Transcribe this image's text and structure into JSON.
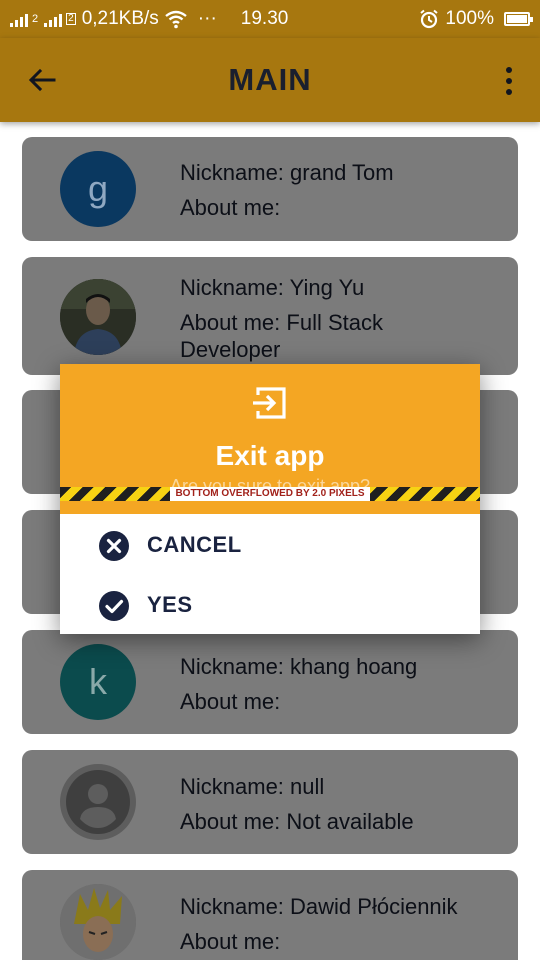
{
  "status_bar": {
    "network_speed": "0,21KB/s",
    "dots": "···",
    "time": "19.30",
    "battery": "100%",
    "sim_label": "2",
    "icons": [
      "signal-icon",
      "signal-icon",
      "wifi-icon",
      "alarm-icon",
      "battery-icon"
    ]
  },
  "app_bar": {
    "title": "MAIN",
    "icons": [
      "arrow-back-icon",
      "more-vert-icon"
    ]
  },
  "users": [
    {
      "avatar_type": "letter",
      "letter": "g",
      "avatar_color": "#0a3860",
      "letter_color": "#8fa8c2",
      "nickname": "Nickname: grand Tom",
      "about": "About me:"
    },
    {
      "avatar_type": "photo",
      "nickname": "Nickname: Ying Yu",
      "about": "About me: Full Stack Developer"
    },
    {
      "avatar_type": "hidden",
      "nickname": "",
      "about": ""
    },
    {
      "avatar_type": "hidden",
      "nickname": "",
      "about": ""
    },
    {
      "avatar_type": "letter",
      "letter": "k",
      "avatar_color": "#0b4b4d",
      "letter_color": "#8aa9a9",
      "nickname": "Nickname: khang hoang",
      "about": "About me:"
    },
    {
      "avatar_type": "placeholder",
      "nickname": "Nickname: null",
      "about": "About me: Not available"
    },
    {
      "avatar_type": "cartoon",
      "nickname": "Nickname: Dawid Płóciennik",
      "about": "About me:"
    }
  ],
  "dialog": {
    "icon": "exit-app-icon",
    "title": "Exit app",
    "subtitle": "Are you sure to exit app?",
    "overflow_warning": "BOTTOM OVERFLOWED BY 2.0 PIXELS",
    "options": [
      {
        "icon": "cancel-icon",
        "label": "CANCEL"
      },
      {
        "icon": "check-circle-icon",
        "label": "YES"
      }
    ]
  },
  "colors": {
    "app_bar": "#a7770f",
    "dialog_header": "#f4a623",
    "option_text": "#1a2340",
    "card_bg_dimmed": "#7b7b7b"
  }
}
